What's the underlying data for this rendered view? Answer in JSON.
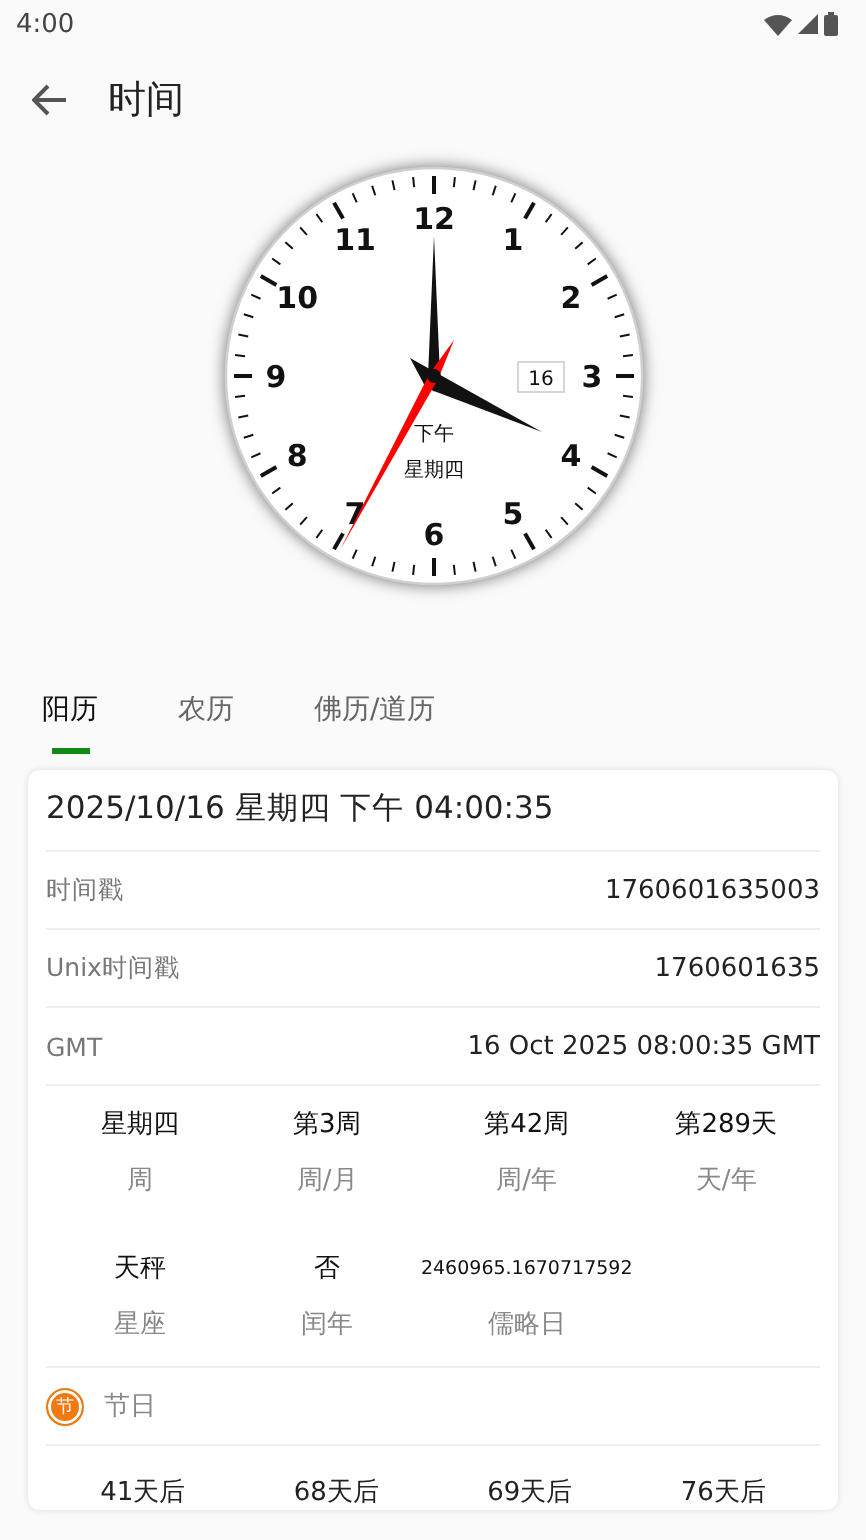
{
  "status_bar": {
    "time": "4:00"
  },
  "app_bar": {
    "title": "时间"
  },
  "clock": {
    "numbers": [
      "12",
      "1",
      "2",
      "3",
      "4",
      "5",
      "6",
      "7",
      "8",
      "9",
      "10",
      "11"
    ],
    "date_badge": "16",
    "period": "下午",
    "weekday": "星期四"
  },
  "tabs": [
    {
      "label": "阳历",
      "selected": true
    },
    {
      "label": "农历",
      "selected": false
    },
    {
      "label": "佛历/道历",
      "selected": false
    }
  ],
  "card": {
    "datetime": "2025/10/16 星期四 下午 04:00:35",
    "rows": [
      {
        "label": "时间戳",
        "value": "1760601635003"
      },
      {
        "label": "Unix时间戳",
        "value": "1760601635"
      },
      {
        "label": "GMT",
        "value": "16 Oct 2025 08:00:35 GMT"
      }
    ],
    "stats": [
      {
        "value": "星期四",
        "label": "周",
        "kind": "normal"
      },
      {
        "value": "第3周",
        "label": "周/月",
        "kind": "normal"
      },
      {
        "value": "第42周",
        "label": "周/年",
        "kind": "normal"
      },
      {
        "value": "第289天",
        "label": "天/年",
        "kind": "normal"
      },
      {
        "value": "天秤",
        "label": "星座",
        "kind": "normal"
      },
      {
        "value": "否",
        "label": "闰年",
        "kind": "normal"
      },
      {
        "value": "2460965.1670717592",
        "label": "儒略日",
        "kind": "long"
      }
    ],
    "holiday_section": {
      "icon_char": "节",
      "title": "节日"
    },
    "countdowns": [
      "41天后",
      "68天后",
      "69天后",
      "76天后"
    ]
  }
}
